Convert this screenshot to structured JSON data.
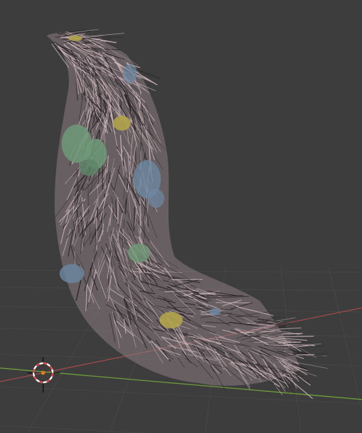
{
  "viewport": {
    "background_color": "#3d3d3d",
    "grid_color": "#474747",
    "x_axis_color": "#9c4a4a",
    "y_axis_color": "#6a9a3a"
  },
  "object": {
    "type": "fur-tail-mesh",
    "fur_color": "#c9b2b8",
    "fur_shadow_color": "#2a2427",
    "patch_colors": {
      "green": "#6f9a78",
      "blue": "#6d87a3",
      "yellow": "#b5a84a"
    }
  },
  "cursor": {
    "icon": "3d-cursor-icon",
    "ring_color_a": "#d94040",
    "ring_color_b": "#ffffff",
    "center_color": "#e07a20"
  }
}
